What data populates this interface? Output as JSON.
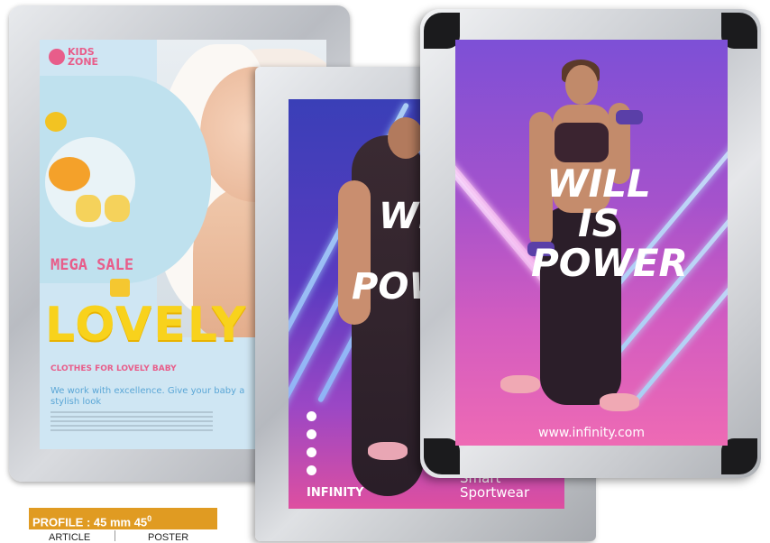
{
  "poster_kids": {
    "logo": "KIDS ZONE",
    "mega_sale": "MEGA SALE",
    "headline": "LOVELY",
    "subtitle": "CLOTHES FOR LOVELY BABY",
    "tagline": "We work with excellence. Give your baby a stylish look"
  },
  "poster_sport_middle": {
    "headline_part1": "WI",
    "headline_part2": "POW",
    "brand": "INFINITY",
    "product": "Smart Sportwear"
  },
  "poster_sport_front": {
    "headline": "WILL IS POWER",
    "url": "www.infinity.com"
  },
  "profile": {
    "label": "PROFILE : 45 mm 45",
    "degree": "0",
    "columns": [
      "ARTICLE",
      "POSTER"
    ]
  }
}
